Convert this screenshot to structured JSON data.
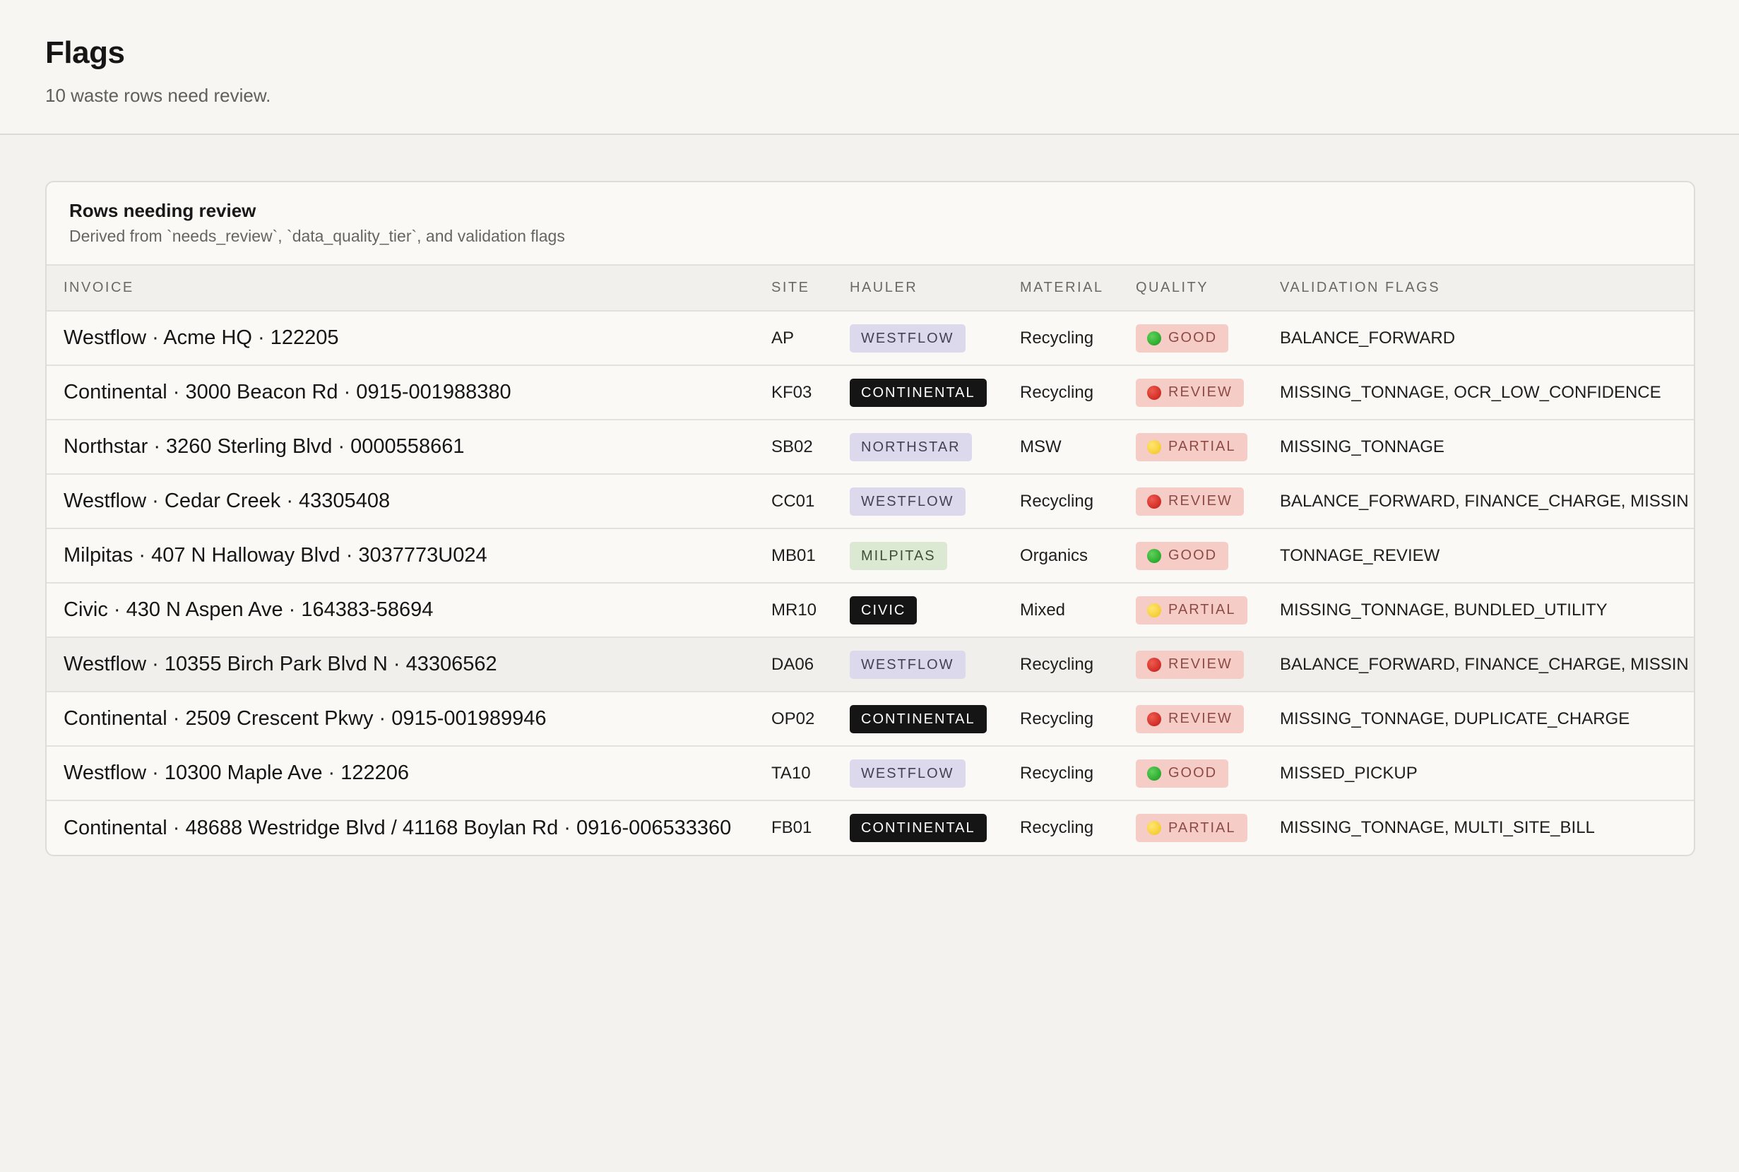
{
  "header": {
    "title": "Flags",
    "subtitle": "10 waste rows need review."
  },
  "card": {
    "title": "Rows needing review",
    "description": "Derived from `needs_review`, `data_quality_tier`, and validation flags"
  },
  "columns": [
    "INVOICE",
    "SITE",
    "HAULER",
    "MATERIAL",
    "QUALITY",
    "VALIDATION FLAGS"
  ],
  "colors": {
    "good": "#1fa823",
    "review": "#d62a22",
    "partial": "#f7cf2f",
    "quality_badge_bg": "#f5ccc6"
  },
  "rows": [
    {
      "invoice": "Westflow · Acme HQ · 122205",
      "site": "AP",
      "hauler": "WESTFLOW",
      "material": "Recycling",
      "quality": "GOOD",
      "flags": "BALANCE_FORWARD"
    },
    {
      "invoice": "Continental · 3000 Beacon Rd · 0915-001988380",
      "site": "KF03",
      "hauler": "CONTINENTAL",
      "material": "Recycling",
      "quality": "REVIEW",
      "flags": "MISSING_TONNAGE, OCR_LOW_CONFIDENCE"
    },
    {
      "invoice": "Northstar · 3260 Sterling Blvd · 0000558661",
      "site": "SB02",
      "hauler": "NORTHSTAR",
      "material": "MSW",
      "quality": "PARTIAL",
      "flags": "MISSING_TONNAGE"
    },
    {
      "invoice": "Westflow · Cedar Creek · 43305408",
      "site": "CC01",
      "hauler": "WESTFLOW",
      "material": "Recycling",
      "quality": "REVIEW",
      "flags": "BALANCE_FORWARD, FINANCE_CHARGE, MISSIN"
    },
    {
      "invoice": "Milpitas · 407 N Halloway Blvd · 3037773U024",
      "site": "MB01",
      "hauler": "MILPITAS",
      "material": "Organics",
      "quality": "GOOD",
      "flags": "TONNAGE_REVIEW"
    },
    {
      "invoice": "Civic · 430 N Aspen Ave · 164383-58694",
      "site": "MR10",
      "hauler": "CIVIC",
      "material": "Mixed",
      "quality": "PARTIAL",
      "flags": "MISSING_TONNAGE, BUNDLED_UTILITY"
    },
    {
      "invoice": "Westflow · 10355 Birch Park Blvd N · 43306562",
      "site": "DA06",
      "hauler": "WESTFLOW",
      "material": "Recycling",
      "quality": "REVIEW",
      "flags": "BALANCE_FORWARD, FINANCE_CHARGE, MISSIN"
    },
    {
      "invoice": "Continental · 2509 Crescent Pkwy · 0915-001989946",
      "site": "OP02",
      "hauler": "CONTINENTAL",
      "material": "Recycling",
      "quality": "REVIEW",
      "flags": "MISSING_TONNAGE, DUPLICATE_CHARGE"
    },
    {
      "invoice": "Westflow · 10300 Maple Ave · 122206",
      "site": "TA10",
      "hauler": "WESTFLOW",
      "material": "Recycling",
      "quality": "GOOD",
      "flags": "MISSED_PICKUP"
    },
    {
      "invoice": "Continental · 48688 Westridge Blvd / 41168 Boylan Rd · 0916-006533360",
      "site": "FB01",
      "hauler": "CONTINENTAL",
      "material": "Recycling",
      "quality": "PARTIAL",
      "flags": "MISSING_TONNAGE, MULTI_SITE_BILL"
    }
  ]
}
